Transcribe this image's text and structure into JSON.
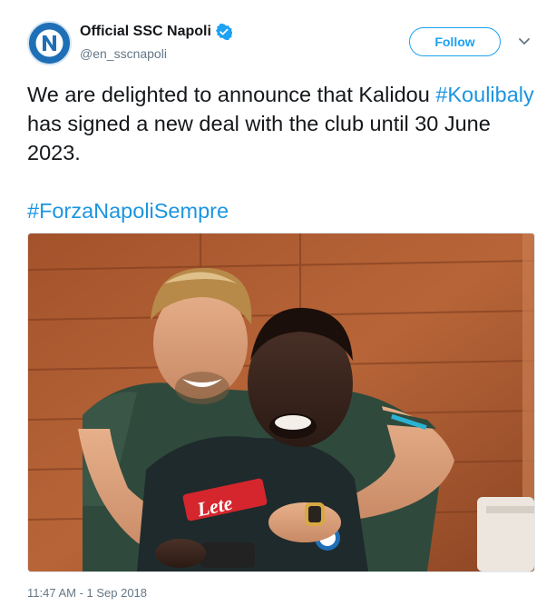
{
  "account": {
    "display_name": "Official SSC Napoli",
    "handle": "@en_sscnapoli",
    "avatar_icon": "napoli-logo-icon",
    "verified_icon": "verified-badge-icon",
    "verified_color": "#1da1f2"
  },
  "follow": {
    "label": "Follow",
    "color": "#1da1f2"
  },
  "menu_icon": "chevron-down-icon",
  "tweet": {
    "text_before_hashtag": "We are delighted to announce that Kalidou ",
    "hashtag_1": "#Koulibaly",
    "text_after_hashtag": " has signed a new deal with the club until 30 June 2023.",
    "hashtag_2": "#ForzaNapoliSempre",
    "hashtag_color": "#1b95e0"
  },
  "photo": {
    "subject": "two-players-embracing-photo",
    "jersey_sponsor": "Lete"
  },
  "timestamp": "11:47 AM - 1 Sep 2018"
}
